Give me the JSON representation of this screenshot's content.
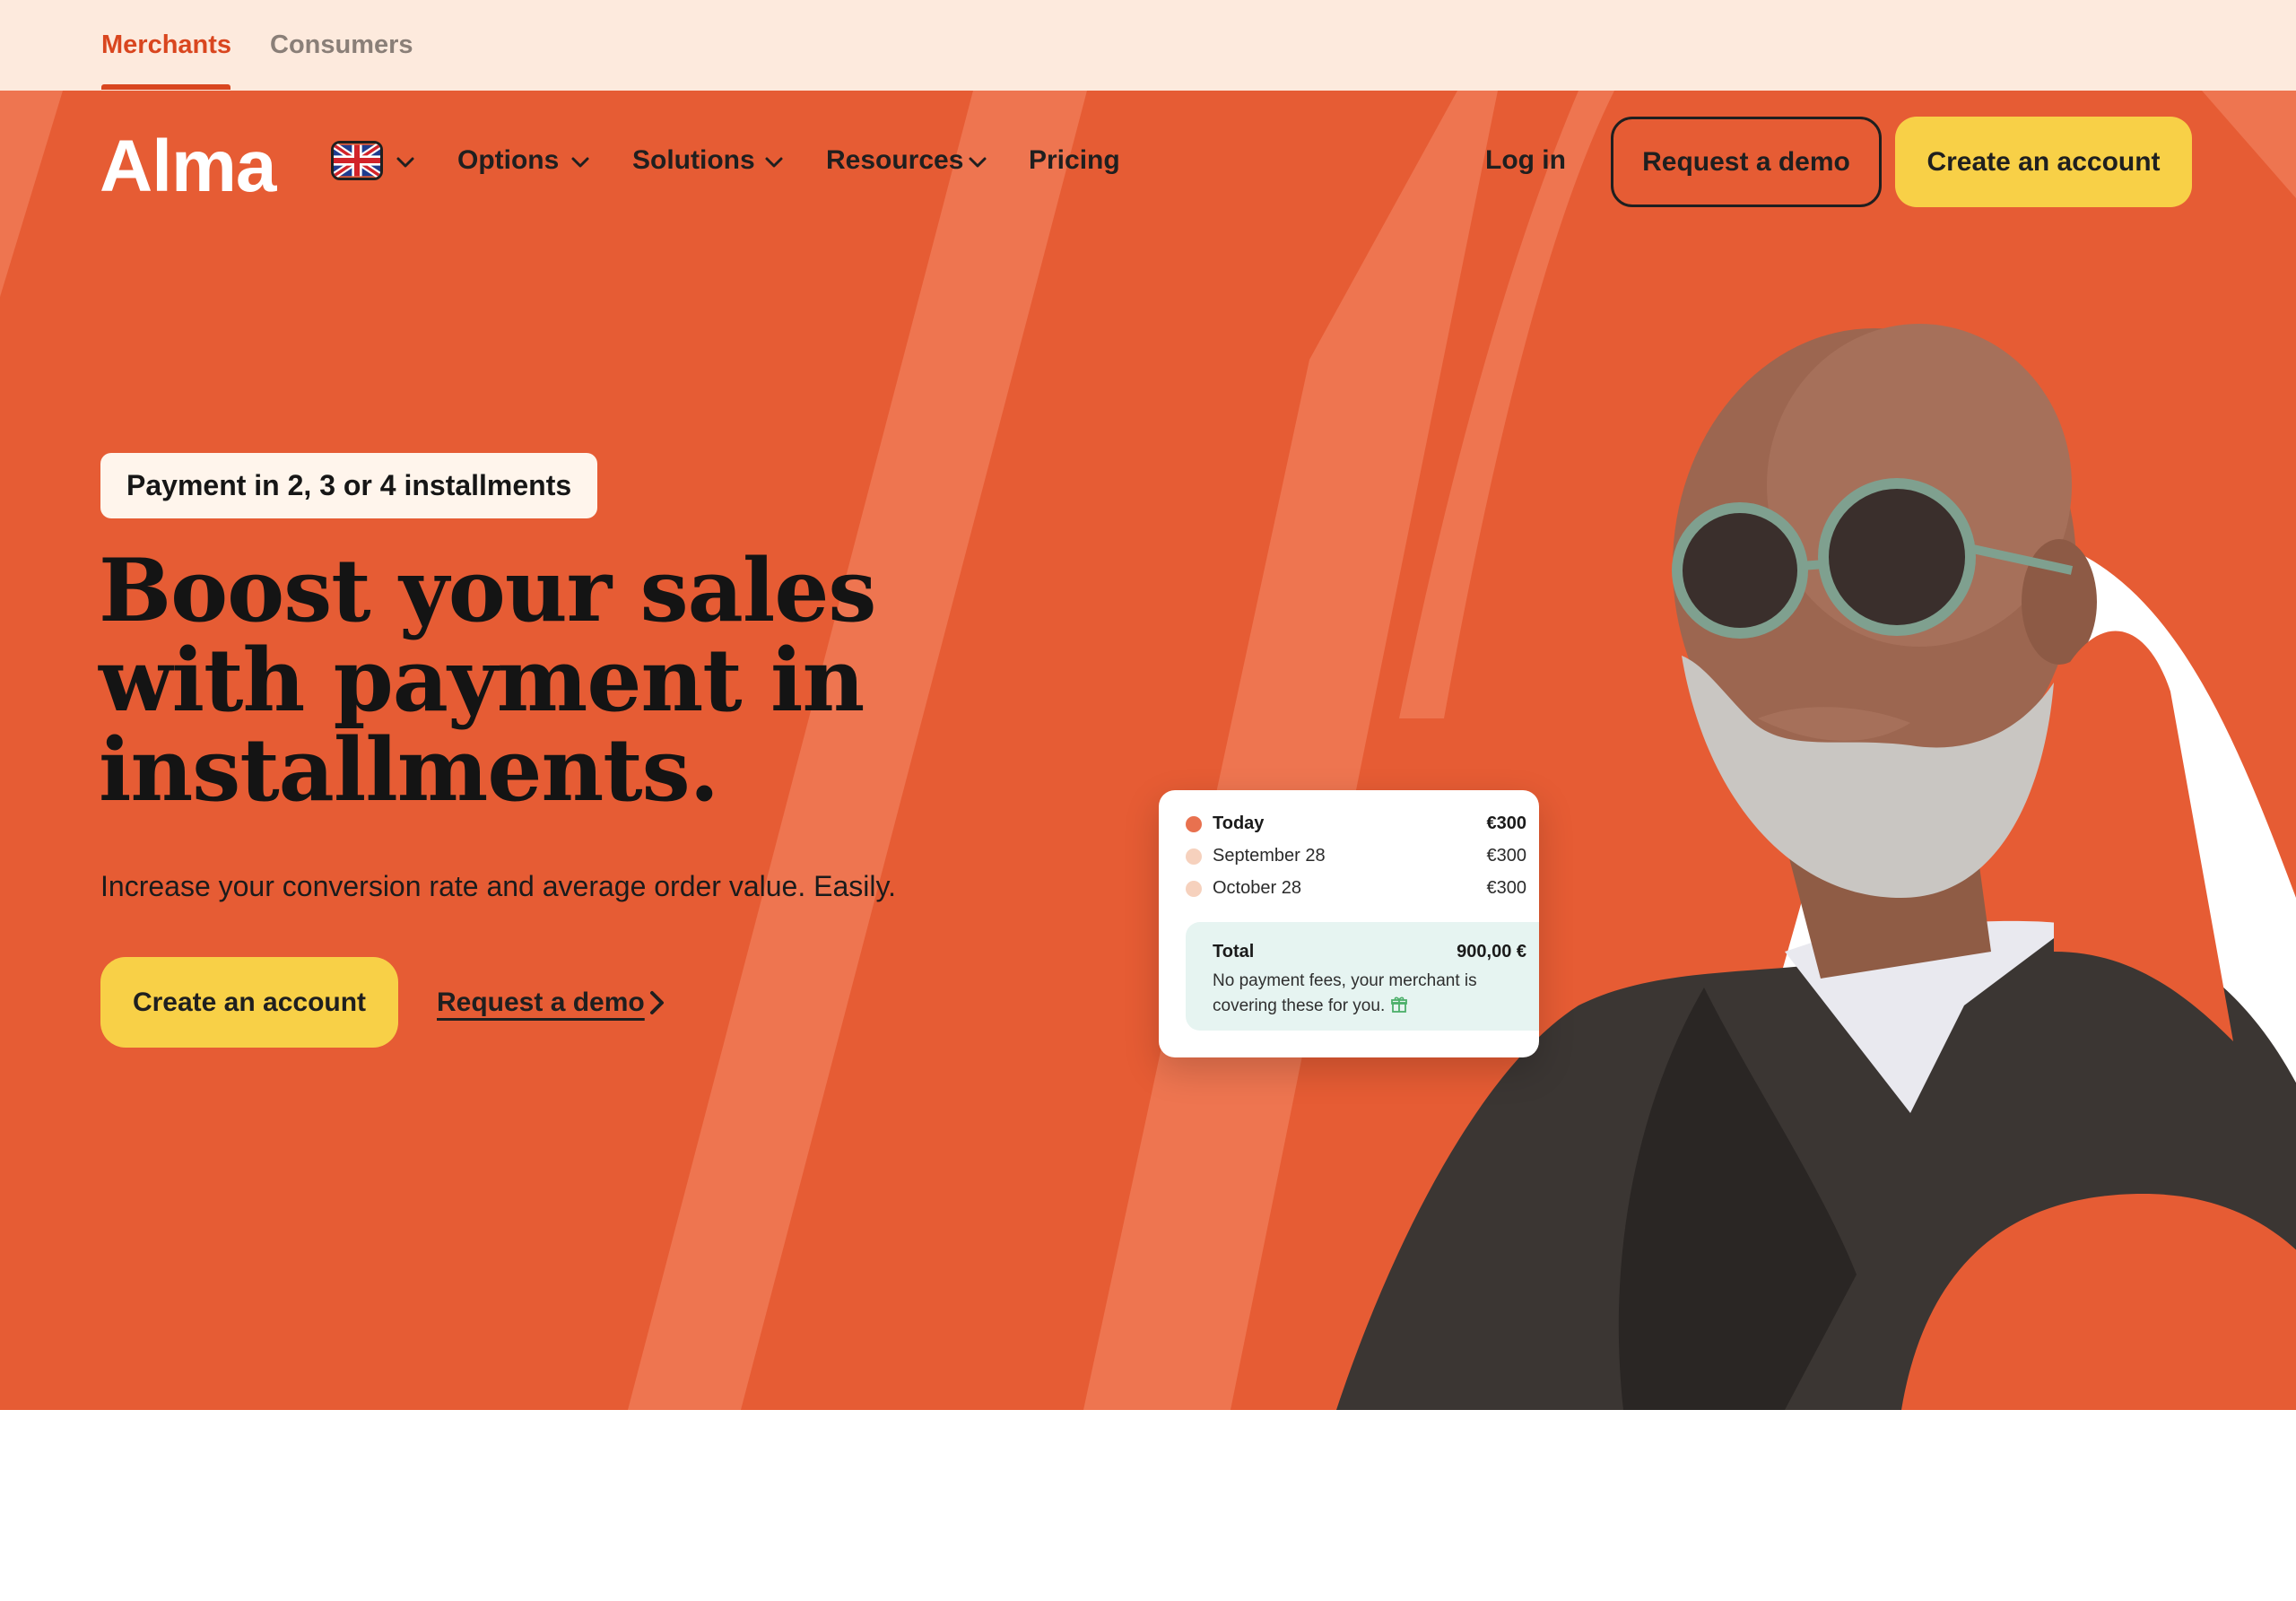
{
  "audience_tabs": {
    "merchants": "Merchants",
    "consumers": "Consumers",
    "active": "Merchants"
  },
  "header": {
    "logo": "Alma",
    "language_icon": "uk-flag-icon",
    "nav": [
      {
        "label": "Options",
        "has_dropdown": true
      },
      {
        "label": "Solutions",
        "has_dropdown": true
      },
      {
        "label": "Resources",
        "has_dropdown": true
      },
      {
        "label": "Pricing",
        "has_dropdown": false
      }
    ],
    "login": "Log in",
    "demo_button": "Request a demo",
    "create_button": "Create an account"
  },
  "hero": {
    "pill": "Payment in 2, 3 or 4 installments",
    "headline": "Boost your sales with payment in installments.",
    "subline": "Increase your conversion rate and average order value. Easily.",
    "cta_primary": "Create an account",
    "cta_secondary": "Request a demo"
  },
  "payment_card": {
    "rows": [
      {
        "label": "Today",
        "amount": "€300"
      },
      {
        "label": "September 28",
        "amount": "€300"
      },
      {
        "label": "October 28",
        "amount": "€300"
      }
    ],
    "total_label": "Total",
    "total_amount": "900,00 €",
    "note": "No payment fees, your merchant is covering these for you."
  },
  "colors": {
    "brand_orange": "#e65c34",
    "accent_yellow": "#f8d047",
    "topbar_bg": "#fdeadd",
    "active_tab": "#d9461f"
  }
}
